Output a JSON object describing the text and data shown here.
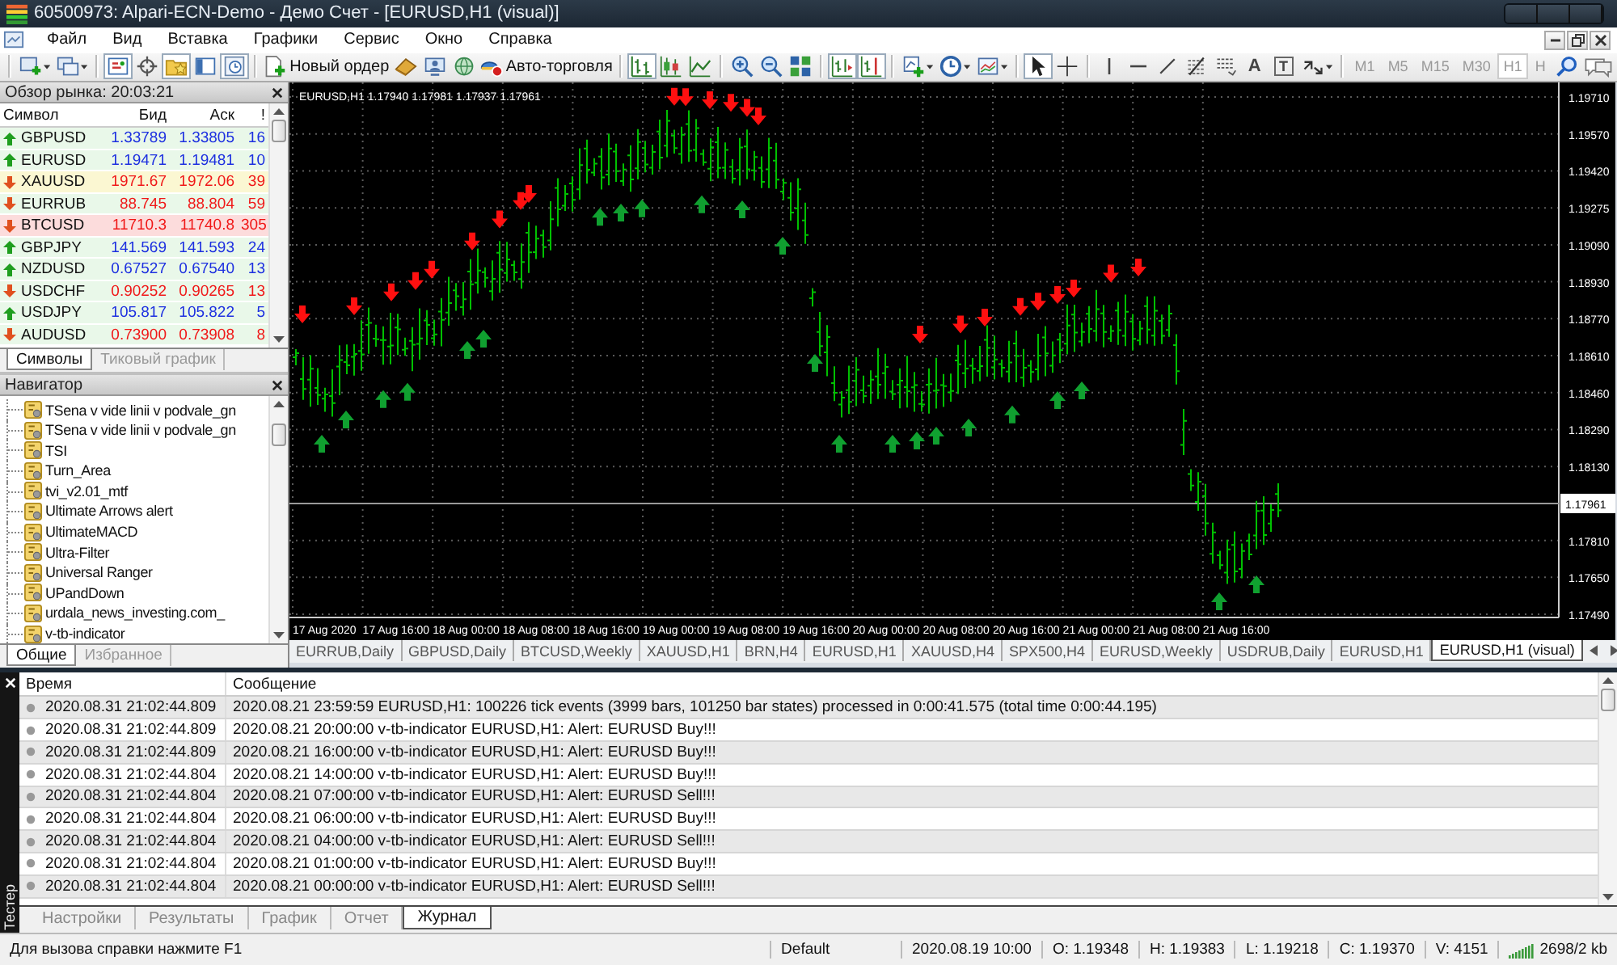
{
  "window": {
    "title": "60500973: Alpari-ECN-Demo - Демо Счет - [EURUSD,H1 (visual)]"
  },
  "menu": [
    "Файл",
    "Вид",
    "Вставка",
    "Графики",
    "Сервис",
    "Окно",
    "Справка"
  ],
  "toolbar": {
    "groups": [
      [
        {
          "kind": "newchart",
          "pressed": false,
          "menu": true
        },
        {
          "kind": "profiles",
          "pressed": false,
          "menu": true
        }
      ],
      [
        {
          "kind": "marketwatch",
          "pressed": true,
          "menu": false
        },
        {
          "kind": "datawindow",
          "pressed": false,
          "menu": false
        },
        {
          "kind": "navigator",
          "pressed": true,
          "menu": false
        },
        {
          "kind": "terminal",
          "pressed": false,
          "menu": false
        },
        {
          "kind": "tester",
          "pressed": true,
          "menu": false
        }
      ],
      [
        {
          "kind": "order",
          "label": "Новый ордер",
          "pressed": false,
          "menu": false
        },
        {
          "kind": "editor",
          "pressed": false,
          "menu": false
        },
        {
          "kind": "people",
          "pressed": false,
          "menu": false
        },
        {
          "kind": "signals",
          "pressed": false,
          "menu": false
        },
        {
          "kind": "autotrade",
          "label": "Авто-торговля",
          "pressed": false,
          "menu": false
        }
      ],
      [
        {
          "kind": "bars",
          "pressed": true,
          "menu": false
        },
        {
          "kind": "candles",
          "pressed": false,
          "menu": false
        },
        {
          "kind": "line",
          "pressed": false,
          "menu": false
        }
      ],
      [
        {
          "kind": "zoomin",
          "pressed": false,
          "menu": false
        },
        {
          "kind": "zoomout",
          "pressed": false,
          "menu": false
        },
        {
          "kind": "tile",
          "pressed": false,
          "menu": false
        }
      ],
      [
        {
          "kind": "autoscroll",
          "pressed": true,
          "menu": false
        },
        {
          "kind": "shift",
          "pressed": true,
          "menu": false
        }
      ],
      [
        {
          "kind": "indicators",
          "pressed": false,
          "menu": true
        },
        {
          "kind": "periods",
          "pressed": false,
          "menu": true
        },
        {
          "kind": "templates",
          "pressed": false,
          "menu": true
        }
      ],
      [
        {
          "kind": "cursor",
          "pressed": true,
          "menu": false
        },
        {
          "kind": "crosshair",
          "pressed": false,
          "menu": false
        }
      ],
      [
        {
          "kind": "vline",
          "pressed": false,
          "menu": false
        },
        {
          "kind": "hline",
          "pressed": false,
          "menu": false
        },
        {
          "kind": "trend",
          "pressed": false,
          "menu": false
        },
        {
          "kind": "fibo",
          "pressed": false,
          "menu": false
        },
        {
          "kind": "channel",
          "pressed": false,
          "menu": false
        },
        {
          "kind": "glyph",
          "label": "A",
          "pressed": false,
          "menu": false
        },
        {
          "kind": "boxglyph",
          "label": "T",
          "pressed": false,
          "menu": false
        },
        {
          "kind": "arrows",
          "pressed": false,
          "menu": true
        }
      ],
      [
        {
          "kind": "timeframe",
          "label": "M1",
          "pressed": false,
          "menu": false
        },
        {
          "kind": "timeframe",
          "label": "M5",
          "pressed": false,
          "menu": false
        },
        {
          "kind": "timeframe",
          "label": "M15",
          "pressed": false,
          "menu": false
        },
        {
          "kind": "timeframe",
          "label": "M30",
          "pressed": false,
          "menu": false
        },
        {
          "kind": "timeframe",
          "label": "H1",
          "pressed": true,
          "menu": false
        },
        {
          "kind": "timeframe",
          "label": "H",
          "pressed": false,
          "menu": false
        },
        {
          "kind": "search",
          "pressed": false,
          "menu": false
        },
        {
          "kind": "chat",
          "pressed": false,
          "menu": false
        }
      ]
    ]
  },
  "market_watch": {
    "title": "Обзор рынка: 20:03:21",
    "columns": [
      "Символ",
      "Бид",
      "Аск",
      "!"
    ],
    "rows": [
      {
        "symbol": "GBPUSD",
        "bid": "1.33789",
        "ask": "1.33805",
        "spread": "16",
        "rising": true,
        "color": "#e9f8e9"
      },
      {
        "symbol": "EURUSD",
        "bid": "1.19471",
        "ask": "1.19481",
        "spread": "10",
        "rising": true,
        "color": "#e9f8e9"
      },
      {
        "symbol": "XAUUSD",
        "bid": "1971.67",
        "ask": "1972.06",
        "spread": "39",
        "rising": false,
        "color": "#fbf7d2"
      },
      {
        "symbol": "EURRUB",
        "bid": "88.745",
        "ask": "88.804",
        "spread": "59",
        "rising": false,
        "color": "#e9f8e9"
      },
      {
        "symbol": "BTCUSD",
        "bid": "11710.3",
        "ask": "11740.8",
        "spread": "305",
        "rising": false,
        "color": "#fcdcdc"
      },
      {
        "symbol": "GBPJPY",
        "bid": "141.569",
        "ask": "141.593",
        "spread": "24",
        "rising": true,
        "color": "#e9f8e9"
      },
      {
        "symbol": "NZDUSD",
        "bid": "0.67527",
        "ask": "0.67540",
        "spread": "13",
        "rising": true,
        "color": "#e9f8e9"
      },
      {
        "symbol": "USDCHF",
        "bid": "0.90252",
        "ask": "0.90265",
        "spread": "13",
        "rising": false,
        "color": "#e9f8e9"
      },
      {
        "symbol": "USDJPY",
        "bid": "105.817",
        "ask": "105.822",
        "spread": "5",
        "rising": true,
        "color": "#e9f8e9"
      },
      {
        "symbol": "AUDUSD",
        "bid": "0.73900",
        "ask": "0.73908",
        "spread": "8",
        "rising": false,
        "color": "#e9f8e9"
      }
    ],
    "tabs": [
      {
        "label": "Символы",
        "selected": true
      },
      {
        "label": "Тиковый график",
        "selected": false
      }
    ]
  },
  "navigator": {
    "title": "Навигатор",
    "items": [
      "TSena v vide linii v podvale_gn",
      "TSena v vide linii v podvale_gn",
      "TSI",
      "Turn_Area",
      "tvi_v2.01_mtf",
      "Ultimate Arrows alert",
      "UltimateMACD",
      "Ultra-Filter",
      "Universal Ranger",
      "UPandDown",
      "urdala_news_investing.com_",
      "v-tb-indicator"
    ],
    "tabs": [
      {
        "label": "Общие",
        "selected": true
      },
      {
        "label": "Избранное",
        "selected": false
      }
    ]
  },
  "chart": {
    "info": "EURUSD,H1  1.17940 1.17981 1.17937 1.17961",
    "y_labels": [
      "1.19710",
      "1.19570",
      "1.19420",
      "1.19275",
      "1.19090",
      "1.18930",
      "1.18770",
      "1.18610",
      "1.18460",
      "1.18290",
      "1.18130",
      "1.17810",
      "1.17650",
      "1.17490"
    ],
    "current_price": "1.17961",
    "x_labels": [
      "17 Aug 2020",
      "17 Aug 16:00",
      "18 Aug 00:00",
      "18 Aug 08:00",
      "18 Aug 16:00",
      "19 Aug 00:00",
      "19 Aug 08:00",
      "19 Aug 16:00",
      "20 Aug 00:00",
      "20 Aug 08:00",
      "20 Aug 16:00",
      "21 Aug 00:00",
      "21 Aug 08:00",
      "21 Aug 16:00"
    ]
  },
  "chart_tabs": [
    {
      "label": "EURRUB,Daily",
      "selected": false
    },
    {
      "label": "GBPUSD,Daily",
      "selected": false
    },
    {
      "label": "BTCUSD,Weekly",
      "selected": false
    },
    {
      "label": "XAUUSD,H1",
      "selected": false
    },
    {
      "label": "BRN,H4",
      "selected": false
    },
    {
      "label": "EURUSD,H1",
      "selected": false
    },
    {
      "label": "XAUUSD,H4",
      "selected": false
    },
    {
      "label": "SPX500,H4",
      "selected": false
    },
    {
      "label": "EURUSD,Weekly",
      "selected": false
    },
    {
      "label": "USDRUB,Daily",
      "selected": false
    },
    {
      "label": "EURUSD,H1",
      "selected": false
    },
    {
      "label": "EURUSD,H1 (visual)",
      "selected": true
    }
  ],
  "terminal": {
    "side_label": "Тестер",
    "columns": [
      "Время",
      "Сообщение"
    ],
    "rows": [
      {
        "time": "2020.08.31 21:02:44.809",
        "message": "2020.08.21 23:59:59  EURUSD,H1: 100226 tick events (3999 bars, 101250 bar states) processed in 0:00:41.575 (total time 0:00:44.195)"
      },
      {
        "time": "2020.08.31 21:02:44.809",
        "message": "2020.08.21 20:00:00  v-tb-indicator EURUSD,H1: Alert: EURUSD Buy!!!"
      },
      {
        "time": "2020.08.31 21:02:44.809",
        "message": "2020.08.21 16:00:00  v-tb-indicator EURUSD,H1: Alert: EURUSD Buy!!!"
      },
      {
        "time": "2020.08.31 21:02:44.804",
        "message": "2020.08.21 14:00:00  v-tb-indicator EURUSD,H1: Alert: EURUSD Buy!!!"
      },
      {
        "time": "2020.08.31 21:02:44.804",
        "message": "2020.08.21 07:00:00  v-tb-indicator EURUSD,H1: Alert: EURUSD Sell!!!"
      },
      {
        "time": "2020.08.31 21:02:44.804",
        "message": "2020.08.21 06:00:00  v-tb-indicator EURUSD,H1: Alert: EURUSD Buy!!!"
      },
      {
        "time": "2020.08.31 21:02:44.804",
        "message": "2020.08.21 04:00:00  v-tb-indicator EURUSD,H1: Alert: EURUSD Sell!!!"
      },
      {
        "time": "2020.08.31 21:02:44.804",
        "message": "2020.08.21 01:00:00  v-tb-indicator EURUSD,H1: Alert: EURUSD Buy!!!"
      },
      {
        "time": "2020.08.31 21:02:44.804",
        "message": "2020.08.21 00:00:00  v-tb-indicator EURUSD,H1: Alert: EURUSD Sell!!!"
      }
    ],
    "tabs": [
      {
        "label": "Настройки",
        "selected": false
      },
      {
        "label": "Результаты",
        "selected": false
      },
      {
        "label": "График",
        "selected": false
      },
      {
        "label": "Отчет",
        "selected": false
      },
      {
        "label": "Журнал",
        "selected": true
      }
    ]
  },
  "status_bar": {
    "help": "Для вызова справки нажмите F1",
    "profile": "Default",
    "fields": [
      "2020.08.19 10:00",
      "O: 1.19348",
      "H: 1.19383",
      "L: 1.19218",
      "C: 1.19370",
      "V: 4151"
    ],
    "traffic": "2698/2 kb"
  }
}
